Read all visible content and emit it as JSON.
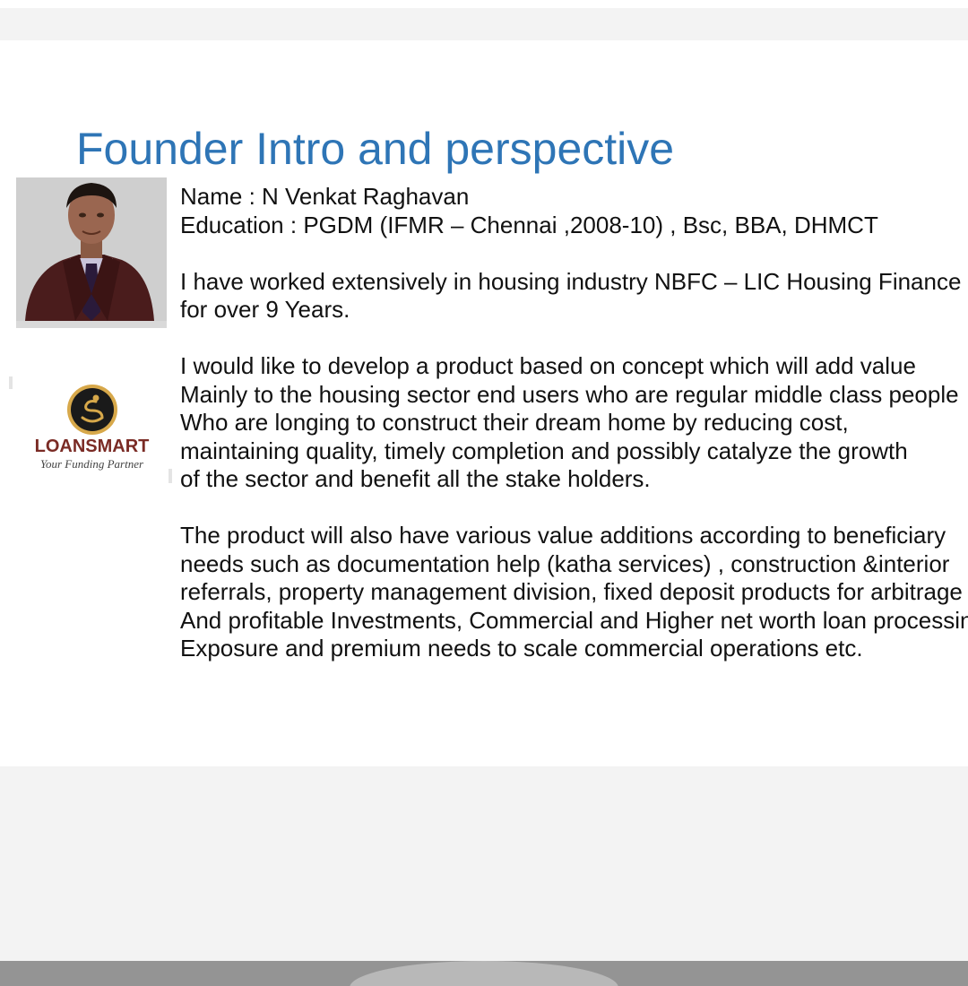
{
  "slide": {
    "title": "Founder Intro and perspective",
    "lines": [
      "Name : N Venkat Raghavan",
      "Education : PGDM (IFMR – Chennai ,2008-10) , Bsc, BBA, DHMCT",
      "",
      " I have worked extensively in housing industry NBFC – LIC Housing Finance",
      "for over 9 Years.",
      "",
      "I would like to develop a product based on concept which will add value",
      "Mainly to the housing sector end users who are regular middle class people",
      "Who are longing to construct their dream home by reducing cost,",
      "maintaining quality, timely completion and possibly catalyze the growth",
      "of the sector and benefit all the stake holders.",
      "",
      "The product will also have various value additions according to beneficiary",
      " needs such as documentation help (katha services) , construction &interior",
      "referrals, property management division, fixed deposit products for arbitrage",
      "And profitable Investments, Commercial and Higher net worth loan processing",
      "Exposure and premium needs to scale commercial operations etc."
    ]
  },
  "logo": {
    "name": "LOANSMART",
    "tagline": "Your Funding Partner",
    "colors": {
      "name": "#7a2b25",
      "emblem": "#d7a84a"
    }
  },
  "colors": {
    "title": "#2e75b6",
    "text": "#111111"
  }
}
